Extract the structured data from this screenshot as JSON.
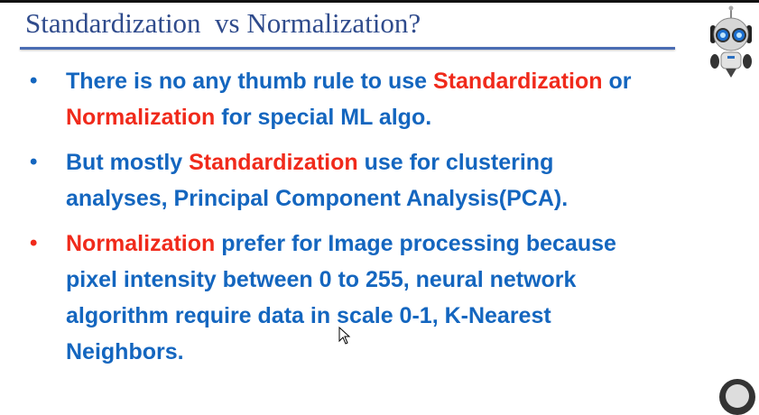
{
  "slide": {
    "title": "Standardization  vs Normalization?",
    "colors": {
      "title": "#2f4b8c",
      "text": "#1466bf",
      "highlight": "#f02a1b"
    },
    "bullets": [
      {
        "bullet_color": "#1466bf",
        "lines": [
          [
            {
              "t": "There is no any thumb rule to use ",
              "c": "blue"
            },
            {
              "t": "Standardization",
              "c": "red"
            },
            {
              "t": " or",
              "c": "blue"
            }
          ],
          [
            {
              "t": "Normalization",
              "c": "red"
            },
            {
              "t": " for special ML algo.",
              "c": "blue"
            }
          ]
        ]
      },
      {
        "bullet_color": "#1466bf",
        "lines": [
          [
            {
              "t": "But mostly ",
              "c": "blue"
            },
            {
              "t": "Standardization",
              "c": "red"
            },
            {
              "t": " use for clustering",
              "c": "blue"
            }
          ],
          [
            {
              "t": "analyses, Principal Component Analysis(PCA).",
              "c": "blue"
            }
          ]
        ]
      },
      {
        "bullet_color": "#f02a1b",
        "lines": [
          [
            {
              "t": "Normalization",
              "c": "red"
            },
            {
              "t": " prefer for Image processing because",
              "c": "blue"
            }
          ],
          [
            {
              "t": "pixel intensity between 0 to 255, neural network",
              "c": "blue"
            }
          ],
          [
            {
              "t": "algorithm require data in scale 0-1, K-Nearest",
              "c": "blue"
            }
          ],
          [
            {
              "t": "Neighbors.",
              "c": "blue"
            }
          ]
        ]
      }
    ],
    "icons": [
      "robot-icon",
      "mouse-cursor-icon"
    ]
  }
}
